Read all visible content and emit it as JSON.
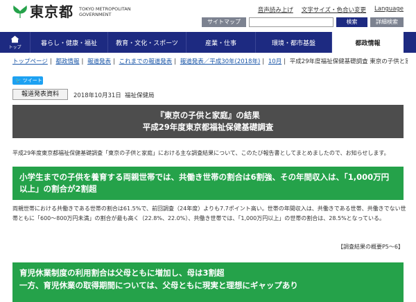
{
  "header": {
    "logo_text": "東京都",
    "logo_en_line1": "TOKYO METROPOLITAN",
    "logo_en_line2": "GOVERNMENT",
    "top_links": [
      "音声読み上げ",
      "文字サイズ・色合い変更",
      "Language"
    ],
    "sitemap_label": "サイトマップ",
    "search_label": "検索",
    "detail_label": "詳細検索",
    "search_placeholder": ""
  },
  "nav": {
    "home_label": "トップ",
    "items": [
      "暮らし・健康・福祉",
      "教育・文化・スポーツ",
      "産業・仕事",
      "環境・都市基盤",
      "都政情報"
    ]
  },
  "breadcrumb": {
    "links": [
      "トップページ",
      "都政情報",
      "報道発表",
      "これまでの報道発表",
      "報道発表／平成30年(2018年)",
      "10月"
    ],
    "current": "平成29年度福祉保健基礎調査 東京の子供と家庭"
  },
  "tweet_label": "ツイート",
  "meta": {
    "badge": "報道発表資料",
    "date": "2018年10月31日",
    "department": "福祉保健局"
  },
  "title": {
    "line1": "『東京の子供と家庭』の結果",
    "line2": "平成29年度東京都福祉保健基礎調査"
  },
  "intro": "平成29年度東京都福祉保健基礎調査「東京の子供と家庭」における主な調査結果について、このたび報告書としてまとめましたので、お知らせします。",
  "section1": {
    "heading": "小学生までの子供を養育する両親世帯では、共働き世帯の割合は6割強、その年間収入は、「1,000万円以上」の割合が2割超",
    "body": "両親世帯における共働きである世帯の割合は61.5%で、前回調査（24年度）よりも7.7ポイント高い。世帯の年間収入は、共働きである世帯、共働きでない世帯ともに「600〜800万円未満」の割合が最も高く（22.8%、22.0%）、共働き世帯では、「1,000万円以上」の世帯の割合は、28.5%となっている。",
    "ref": "【調査結果の概要P5〜6】"
  },
  "section2": {
    "line1": "育児休業制度の利用割合は父母ともに増加し、母は3割超",
    "line2": "一方、育児休業の取得期間については、父母ともに現実と理想にギャップあり"
  },
  "colors": {
    "nav_bg": "#1d2a81",
    "green": "#25a24a",
    "title_bg": "#4d4d4d",
    "link": "#1a56a8",
    "tweet": "#1da1f2"
  }
}
